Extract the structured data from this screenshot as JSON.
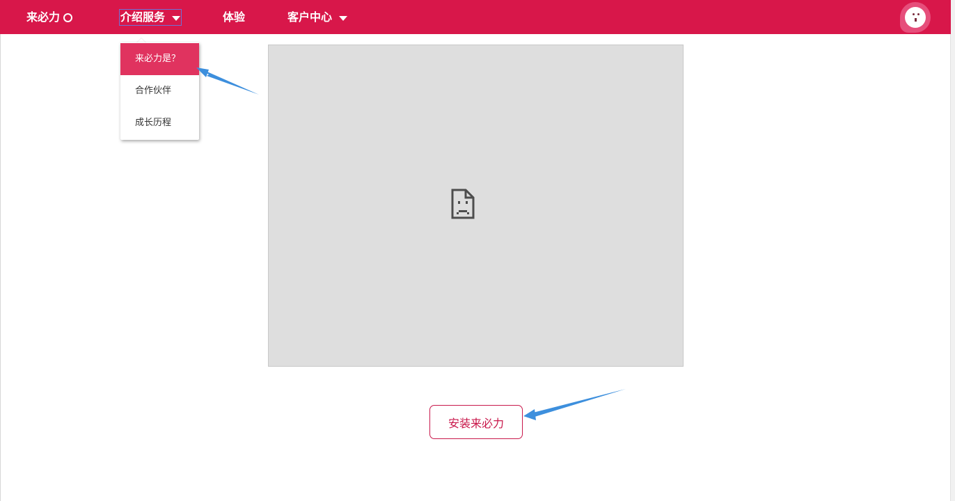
{
  "nav": {
    "brand": "来必力",
    "items": [
      {
        "label": "介绍服务",
        "has_caret": true,
        "active": true
      },
      {
        "label": "体验",
        "has_caret": false,
        "active": false
      },
      {
        "label": "客户中心",
        "has_caret": true,
        "active": false
      }
    ]
  },
  "dropdown": {
    "items": [
      {
        "label": "来必力是？",
        "selected": true
      },
      {
        "label": "合作伙伴",
        "selected": false
      },
      {
        "label": "成长历程",
        "selected": false
      }
    ]
  },
  "main": {
    "install_button": "安装来必力"
  },
  "colors": {
    "brand": "#d8174a",
    "dropdown_selected": "#e0335f",
    "annotation_arrow": "#3d8fdd",
    "media_placeholder": "#dedede"
  },
  "icons": {
    "broken_image": "broken-image-icon",
    "avatar": "avatar-face-icon"
  }
}
